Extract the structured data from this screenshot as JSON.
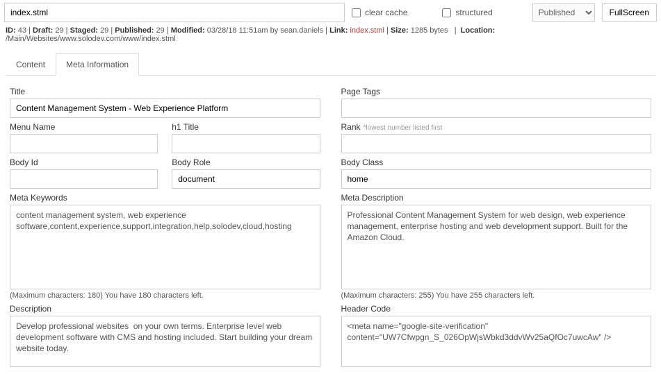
{
  "top": {
    "filename": "index.stml",
    "clear_cache_label": "clear cache",
    "structured_label": "structured",
    "publish_state": "Published",
    "fullscreen_label": "FullScreen"
  },
  "meta_line": {
    "id_label": "ID:",
    "id": "43",
    "draft_label": "Draft:",
    "draft": "29",
    "staged_label": "Staged:",
    "staged": "29",
    "published_label": "Published:",
    "published": "29",
    "modified_label": "Modified:",
    "modified": "03/28/18 11:51am by sean.daniels",
    "link_label": "Link:",
    "link": "index.stml",
    "size_label": "Size:",
    "size": "1285 bytes",
    "location_label": "Location:",
    "location": "/Main/Websites/www.solodev.com/www/index.stml"
  },
  "tabs": {
    "content": "Content",
    "meta_info": "Meta Information"
  },
  "form": {
    "title_label": "Title",
    "title_value": "Content Management System - Web Experience Platform",
    "page_tags_label": "Page Tags",
    "page_tags_value": "",
    "menu_name_label": "Menu Name",
    "menu_name_value": "",
    "h1_label": "h1 Title",
    "h1_value": "",
    "rank_label": "Rank",
    "rank_hint": "*lowest number listed first",
    "rank_value": "",
    "body_id_label": "Body Id",
    "body_id_value": "",
    "body_role_label": "Body Role",
    "body_role_value": "document",
    "body_class_label": "Body Class",
    "body_class_value": "home",
    "meta_keywords_label": "Meta Keywords",
    "meta_keywords_value": "content management system, web experience software,content,experience,support,integration,help,solodev,cloud,hosting",
    "meta_keywords_counter": "(Maximum characters: 180) You have 180 characters left.",
    "meta_description_label": "Meta Description",
    "meta_description_value": "Professional Content Management System for web design, web experience management, enterprise hosting and web development support. Built for the Amazon Cloud.",
    "meta_description_counter": "(Maximum characters: 255) You have 255 characters left.",
    "description_label": "Description",
    "description_value": "Develop professional websites  on your own terms. Enterprise level web development software with CMS and hosting included. Start building your dream website today.",
    "header_code_label": "Header Code",
    "header_code_value": "<meta name=\"google-site-verification\" content=\"UW7Cfwpgn_S_026OpWjsWbkd3ddvWv25aQfOc7uwcAw\" />"
  }
}
